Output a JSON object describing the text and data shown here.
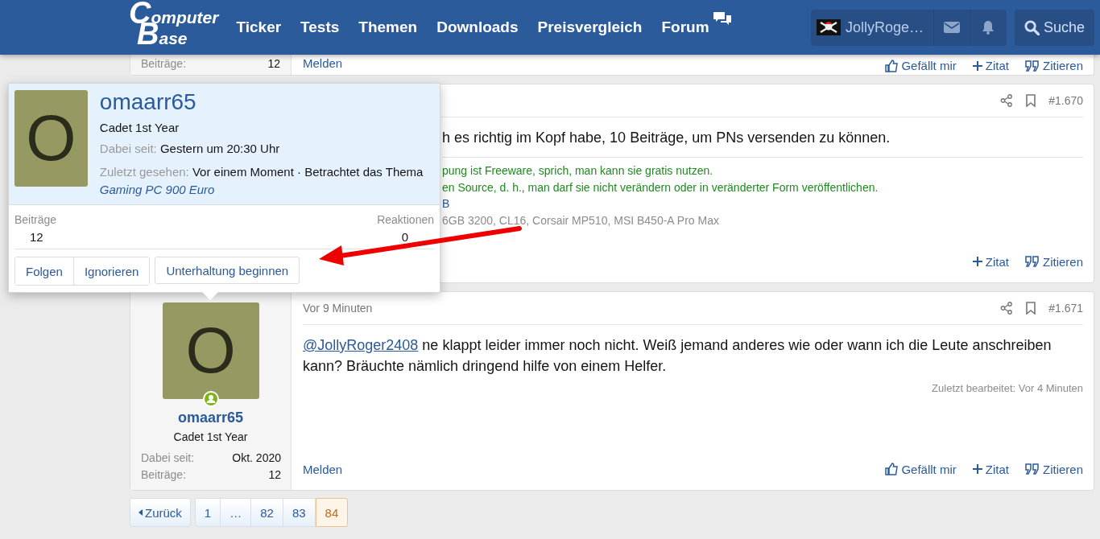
{
  "header": {
    "logo": {
      "top": "Computer",
      "bottom": "Base"
    },
    "nav": [
      {
        "label": "Ticker"
      },
      {
        "label": "Tests"
      },
      {
        "label": "Themen"
      },
      {
        "label": "Downloads"
      },
      {
        "label": "Preisvergleich"
      },
      {
        "label": "Forum",
        "kind": "forum"
      }
    ],
    "user": {
      "name": "JollyRoge…"
    },
    "search": "Suche"
  },
  "previous_post": {
    "stat": {
      "label": "Beiträge:",
      "value": "12"
    },
    "report": "Melden",
    "actions": [
      {
        "kind": "like",
        "label": "Gefällt mir"
      },
      {
        "kind": "quote",
        "label": "Zitat"
      },
      {
        "kind": "reply",
        "label": "Zitieren"
      }
    ]
  },
  "post_1670": {
    "number": "#1.670",
    "message": "h es richtig im Kopf habe, 10 Beiträge, um PNs versenden zu können.",
    "signature": [
      {
        "text": "pung ist Freeware, sprich, man kann sie gratis nutzen.",
        "color": "#1f8a1f"
      },
      {
        "text": "en Source, d. h., man darf sie nicht verändern oder in veränderter Form veröffentlichen.",
        "color": "#1f8a1f"
      },
      {
        "text": "B",
        "color": "#2a5a9a"
      },
      {
        "text": "6GB 3200, CL16, Corsair MP510, MSI B450-A Pro Max",
        "color": "#8c8c8c"
      }
    ],
    "actions": [
      {
        "kind": "quote",
        "label": "Zitat"
      },
      {
        "kind": "reply",
        "label": "Zitieren"
      }
    ]
  },
  "post_1671": {
    "author": {
      "initial": "O",
      "name": "omaarr65",
      "title": "Cadet 1st Year",
      "online": true,
      "stats": [
        {
          "label": "Dabei seit:",
          "value": "Okt. 2020"
        },
        {
          "label": "Beiträge:",
          "value": "12"
        }
      ]
    },
    "time": "Vor 9 Minuten",
    "number": "#1.671",
    "mention": "@JollyRoger2408",
    "message": " ne klappt leider immer noch nicht. Weiß jemand anderes wie oder wann ich die Leute anschreiben kann? Bräuchte nämlich dringend hilfe von einem Helfer.",
    "edited": "Zuletzt bearbeitet: Vor 4 Minuten",
    "report": "Melden",
    "actions": [
      {
        "kind": "like",
        "label": "Gefällt mir"
      },
      {
        "kind": "quote",
        "label": "Zitat"
      },
      {
        "kind": "reply",
        "label": "Zitieren"
      }
    ]
  },
  "pagination": {
    "previous": "Zurück",
    "pages": [
      {
        "label": "1",
        "selected": false
      },
      {
        "label": "…",
        "selected": false
      },
      {
        "label": "82",
        "selected": false
      },
      {
        "label": "83",
        "selected": false
      },
      {
        "label": "84",
        "selected": true
      }
    ]
  },
  "member_card": {
    "initial": "O",
    "name": "omaarr65",
    "title": "Cadet 1st Year",
    "joined": {
      "label": "Dabei seit:",
      "value": "Gestern um 20:30 Uhr"
    },
    "last_seen": {
      "label": "Zuletzt gesehen:",
      "value": "Vor einem Moment · Betrachtet das Thema ",
      "thread": "Gaming PC 900 Euro"
    },
    "stats": [
      {
        "label": "Beiträge",
        "value": "12"
      },
      {
        "label": "Reaktionen",
        "value": "0"
      }
    ],
    "buttons": [
      {
        "label": "Folgen",
        "group": true
      },
      {
        "label": "Ignorieren",
        "group": true
      },
      {
        "label": "Unterhaltung beginnen",
        "group": false
      }
    ]
  }
}
